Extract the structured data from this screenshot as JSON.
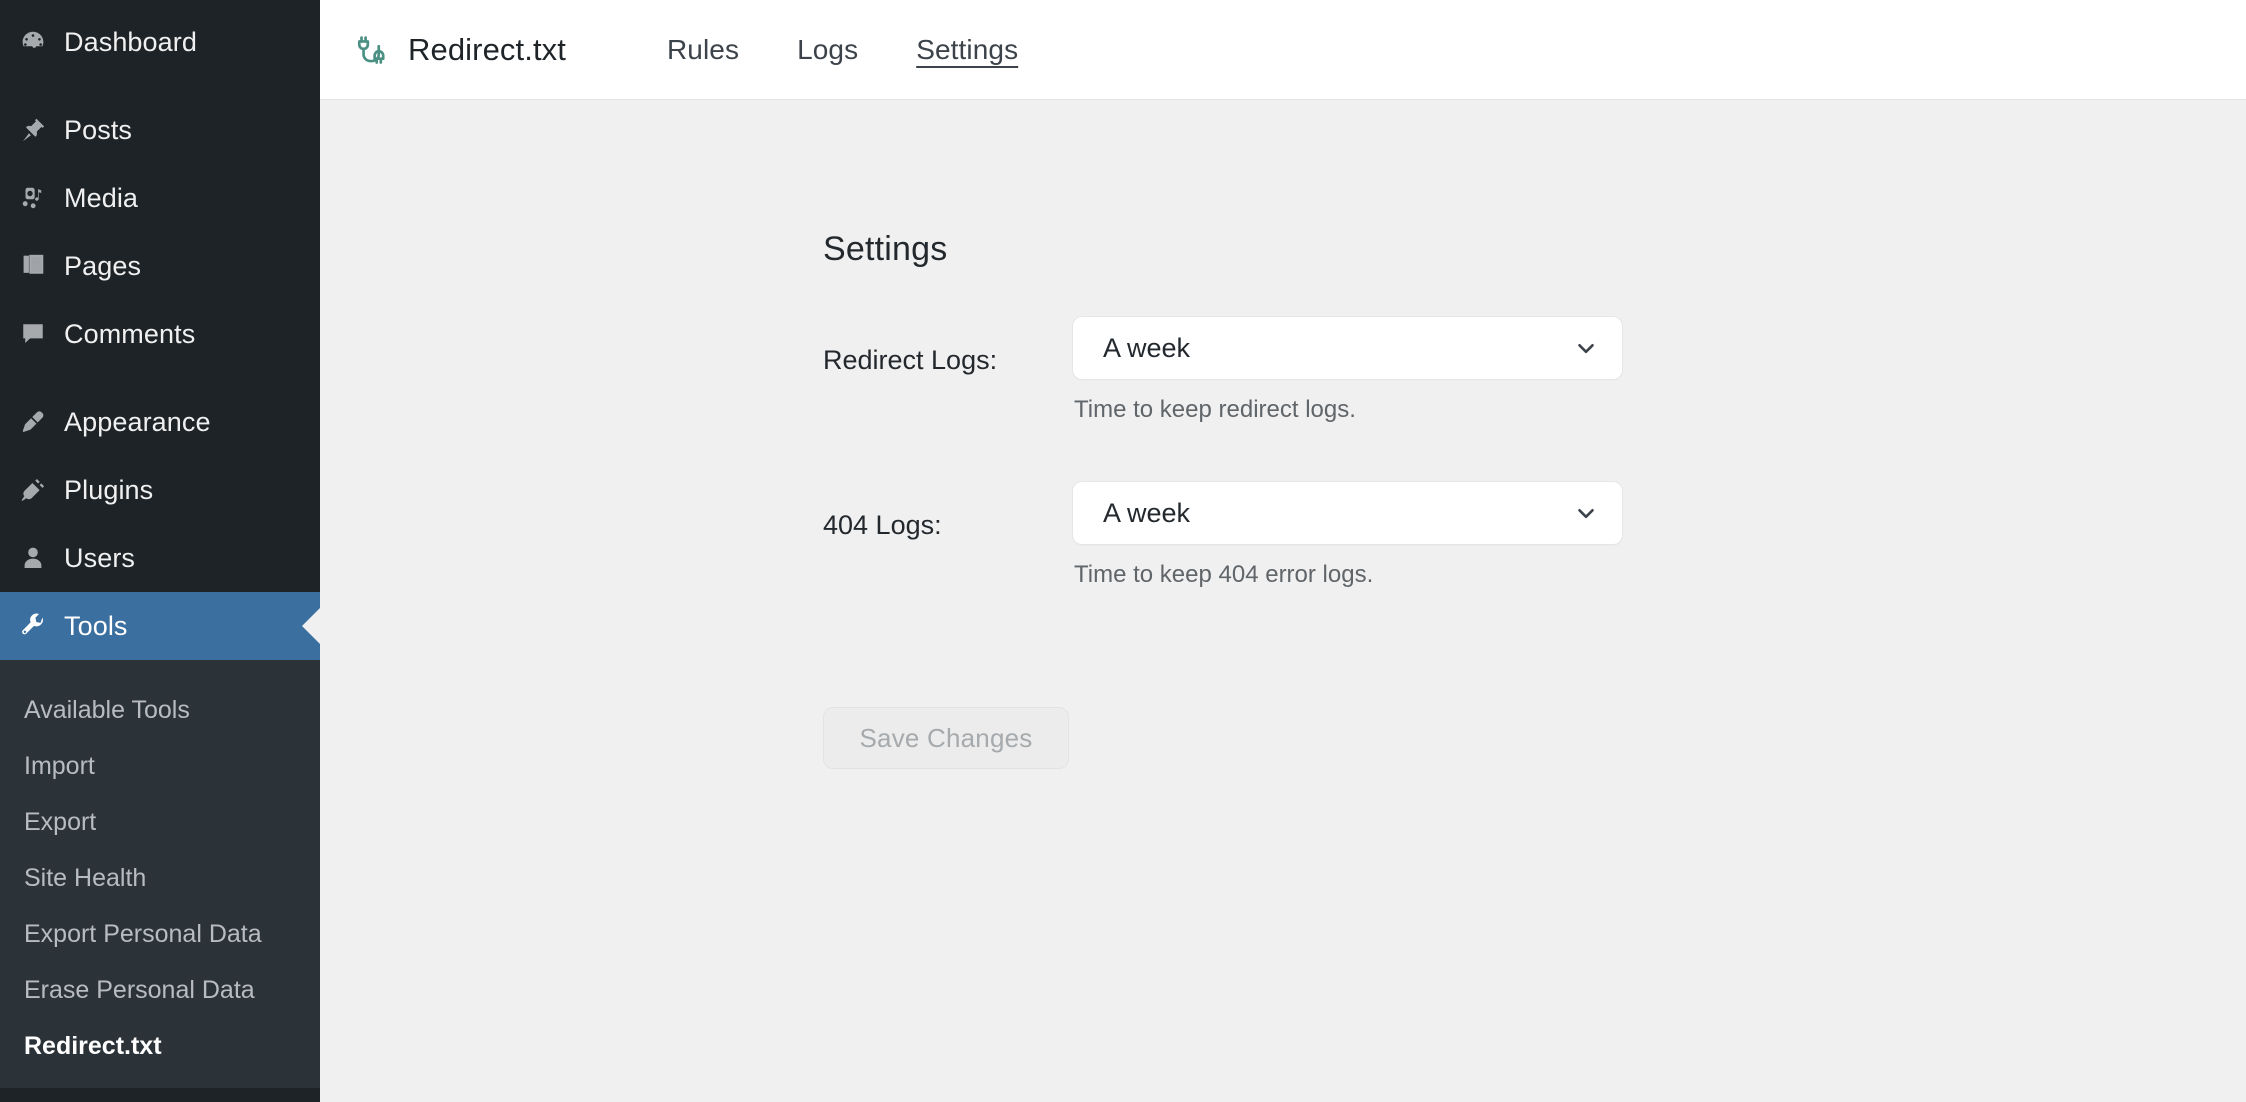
{
  "sidebar": {
    "items": [
      {
        "label": "Dashboard",
        "icon": "dashboard-gauge-icon",
        "active": false
      },
      {
        "label": "Posts",
        "icon": "pin-icon",
        "active": false
      },
      {
        "label": "Media",
        "icon": "media-icon",
        "active": false
      },
      {
        "label": "Pages",
        "icon": "pages-icon",
        "active": false
      },
      {
        "label": "Comments",
        "icon": "comment-bubble-icon",
        "active": false
      },
      {
        "label": "Appearance",
        "icon": "paintbrush-icon",
        "active": false
      },
      {
        "label": "Plugins",
        "icon": "plug-icon",
        "active": false
      },
      {
        "label": "Users",
        "icon": "user-icon",
        "active": false
      },
      {
        "label": "Tools",
        "icon": "wrench-icon",
        "active": true
      }
    ],
    "submenu": [
      {
        "label": "Available Tools",
        "current": false
      },
      {
        "label": "Import",
        "current": false
      },
      {
        "label": "Export",
        "current": false
      },
      {
        "label": "Site Health",
        "current": false
      },
      {
        "label": "Export Personal Data",
        "current": false
      },
      {
        "label": "Erase Personal Data",
        "current": false
      },
      {
        "label": "Redirect.txt",
        "current": true
      }
    ],
    "colors": {
      "background": "#1d2327",
      "submenu_background": "#2c3338",
      "active_background": "#3a6f9f",
      "text": "#f0f0f1",
      "icon": "#a7aaad"
    }
  },
  "header": {
    "brand_title": "Redirect.txt",
    "brand_icon": "cable-plug-icon",
    "brand_icon_color": "#4b9183",
    "tabs": [
      {
        "label": "Rules",
        "active": false
      },
      {
        "label": "Logs",
        "active": false
      },
      {
        "label": "Settings",
        "active": true
      }
    ]
  },
  "settings": {
    "page_title": "Settings",
    "fields": [
      {
        "label": "Redirect Logs:",
        "value": "A week",
        "help": "Time to keep redirect logs.",
        "options": [
          "A week"
        ]
      },
      {
        "label": "404 Logs:",
        "value": "A week",
        "help": "Time to keep 404 error logs.",
        "options": [
          "A week"
        ]
      }
    ],
    "save_label": "Save Changes",
    "save_disabled": true
  }
}
